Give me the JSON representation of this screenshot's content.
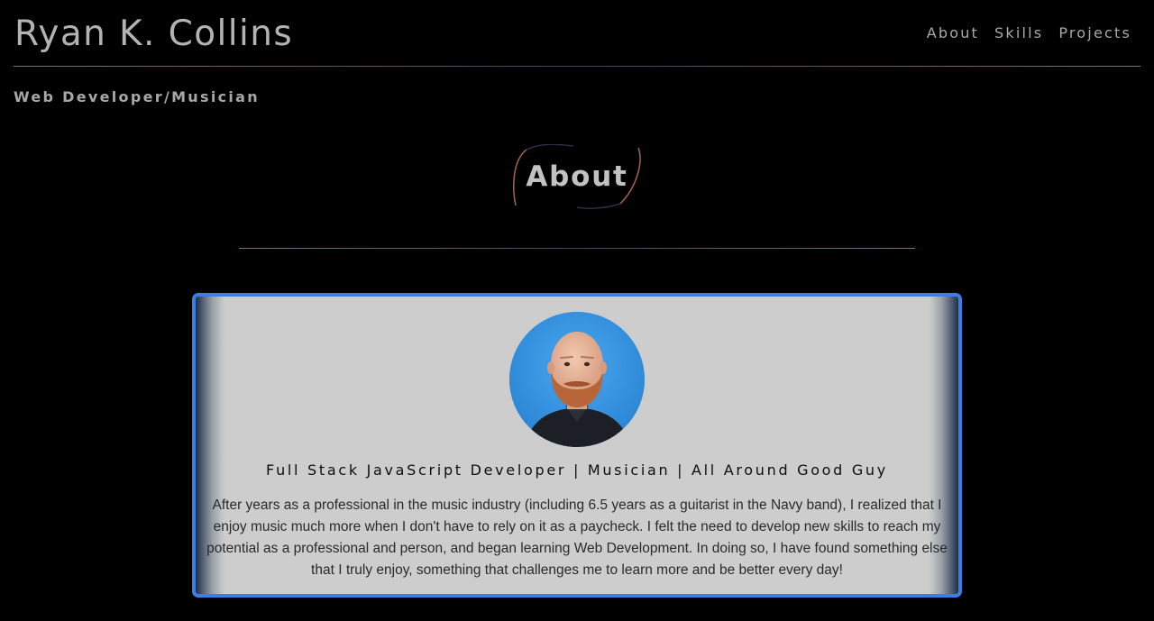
{
  "header": {
    "site_title": "Ryan K. Collins",
    "nav": [
      {
        "label": "About"
      },
      {
        "label": "Skills"
      },
      {
        "label": "Projects"
      }
    ]
  },
  "tagline": "Web Developer/Musician",
  "about_section": {
    "heading": "About",
    "card": {
      "subtitle": "Full Stack JavaScript Developer | Musician | All Around Good Guy",
      "body": "After years as a professional in the music industry (including 6.5 years as a guitarist in the Navy band), I realized that I enjoy music much more when I don't have to rely on it as a paycheck. I felt the need to develop new skills to reach my potential as a professional and person, and began learning Web Development. In doing so, I have found something else that I truly enjoy, something that challenges me to learn more and be better every day!"
    }
  },
  "colors": {
    "background": "#000000",
    "accent_rule": "#a0664f",
    "card_border": "#3d7fe0",
    "card_background": "#cdcdcd",
    "avatar_background": "#2f97e6"
  }
}
